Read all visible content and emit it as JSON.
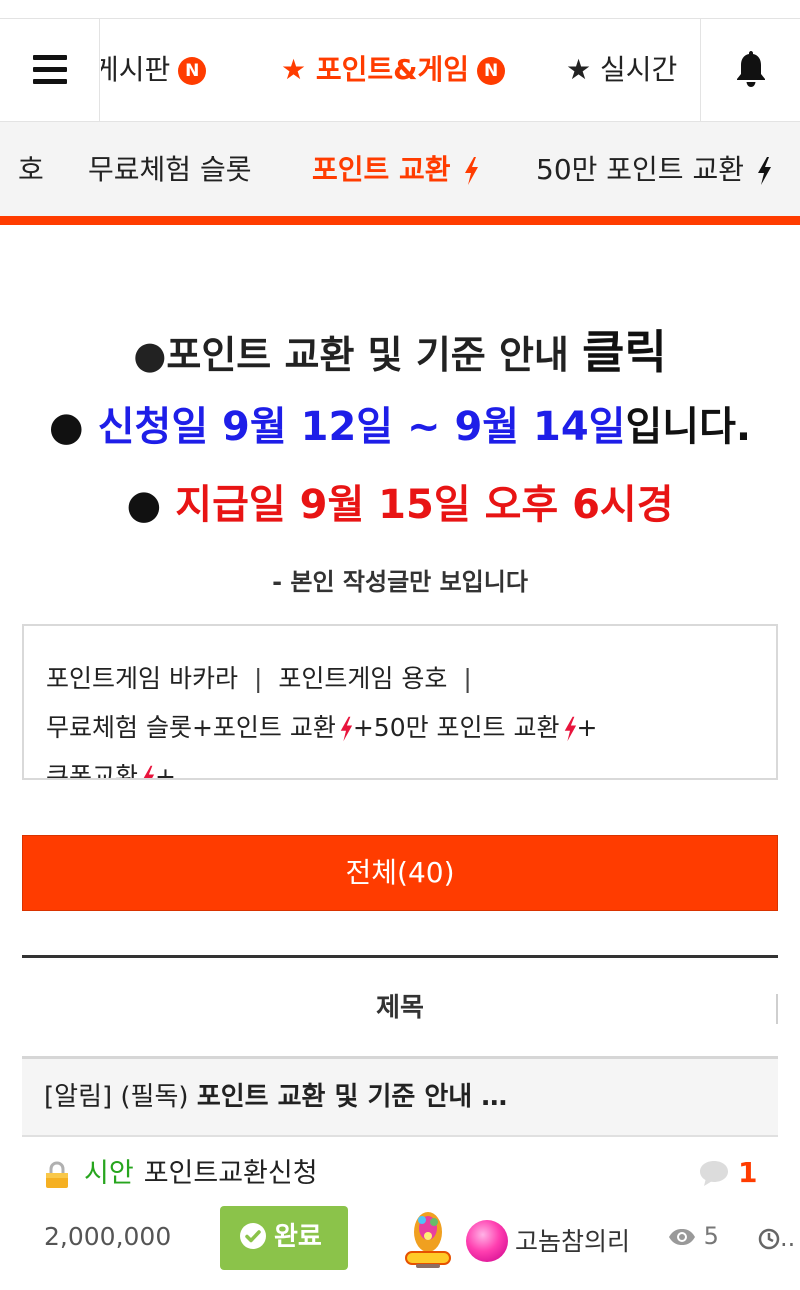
{
  "topnav": {
    "tabs": [
      {
        "label": "게시판",
        "badge": "N"
      },
      {
        "label": "★ 포인트&게임",
        "badge": "N"
      },
      {
        "label": "★ 실시간"
      }
    ]
  },
  "subnav": {
    "items": [
      {
        "label": "호"
      },
      {
        "label": "무료체험 슬롯"
      },
      {
        "label": "포인트 교환"
      },
      {
        "label": "50만 포인트 교환"
      }
    ]
  },
  "notice": {
    "line1_text": "●포인트 교환 및 기준 안내 ",
    "line1_click": "클릭",
    "line2_dot": "● ",
    "line2_dates": "신청일 9월 12일 ~ 9월 14일",
    "line2_tail": "입니다.",
    "line3_dot": "● ",
    "line3_text": "지급일 9월 15일 오후 6시경",
    "line4": "- 본인 작성글만 보입니다"
  },
  "links": {
    "baccarat": "포인트게임 바카라",
    "dragon": "포인트게임 용호",
    "sep": "|",
    "free_slot": "무료체험 슬롯+포인트 교환",
    "plus1": "+50만 포인트 교환",
    "plus2": "+",
    "coupon": "쿠폰교환",
    "plus3": "+"
  },
  "all_button": "전체(40)",
  "table": {
    "header_title": "제목",
    "notice_row": {
      "tag": "[알림]",
      "prefix": " (필독) ",
      "title": "포인트 교환 및 기준 안내 …"
    }
  },
  "post": {
    "category": "시안",
    "title": "포인트교환신청",
    "comments": "1",
    "points": "2,000,000",
    "status": "완료",
    "author": "고놈참의리",
    "views": "5",
    "time": ".."
  },
  "colors": {
    "accent": "#ff3c00",
    "blue": "#1e1ee8",
    "red": "#e81414",
    "green": "#27a51e",
    "done": "#8bc34a"
  }
}
